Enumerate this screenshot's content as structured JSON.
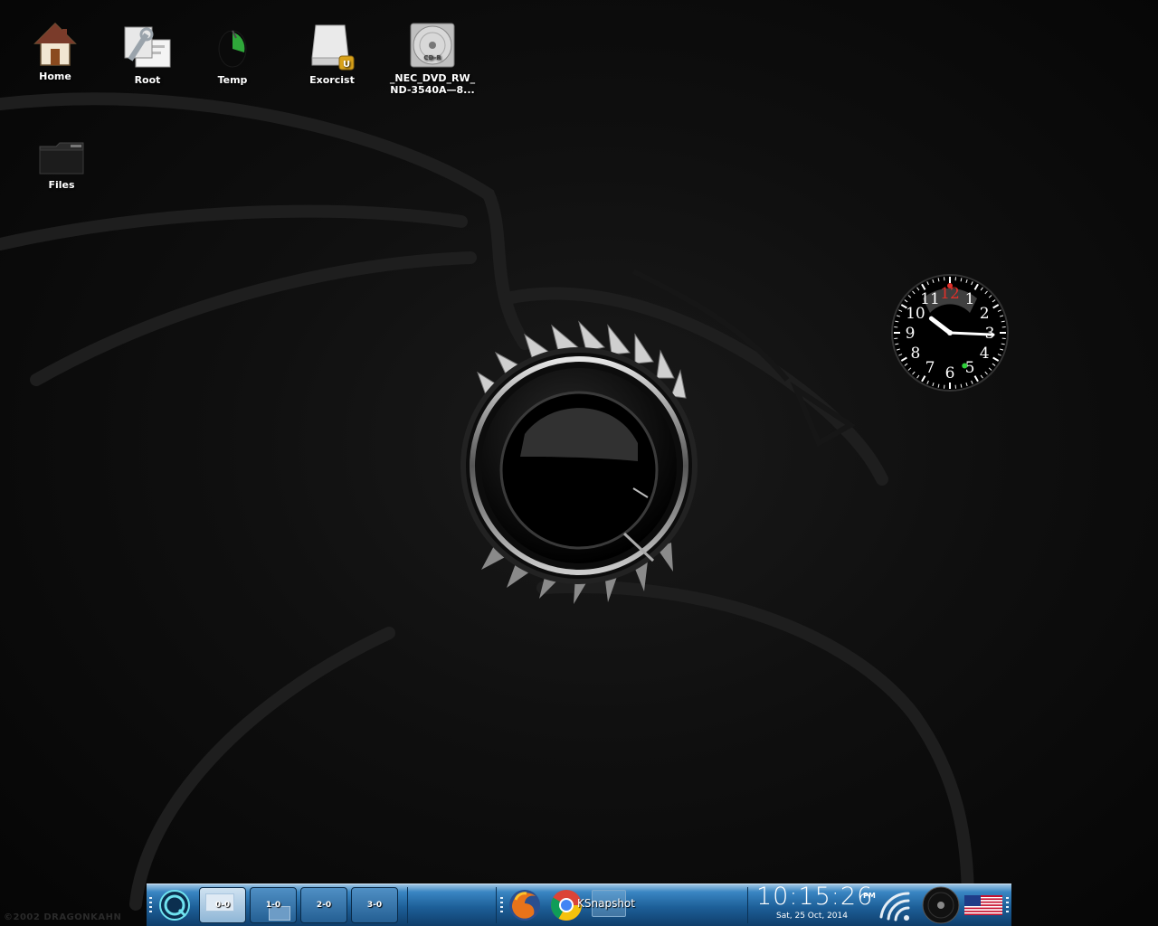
{
  "desktop": {
    "icons": [
      {
        "label": "Home"
      },
      {
        "label": "Root"
      },
      {
        "label": "Temp"
      },
      {
        "label": "Exorcist"
      },
      {
        "label": "_NEC_DVD_RW_\nND-3540A—8..."
      },
      {
        "label": "Files"
      }
    ],
    "cd_badge": "CD-R",
    "drive_badge": "U",
    "watermark": "©2002 DRAGONKAHN"
  },
  "analog_clock": {
    "numerals": [
      "12",
      "1",
      "2",
      "3",
      "4",
      "5",
      "6",
      "7",
      "8",
      "9",
      "10",
      "11"
    ],
    "hour": 10,
    "minute": 15,
    "second": 26
  },
  "taskbar": {
    "pagers": [
      {
        "label": "0-0",
        "active": true
      },
      {
        "label": "1-0",
        "active": false
      },
      {
        "label": "2-0",
        "active": false
      },
      {
        "label": "3-0",
        "active": false
      }
    ],
    "task_label": "KSnapshot",
    "clock_time": "10:15:26",
    "clock_ampm": "PM",
    "clock_date": "Sat, 25 Oct, 2014"
  },
  "colors": {
    "taskbar_top": "#9fc6e4",
    "taskbar_bottom": "#0f3e6b",
    "clock_accent": "#e0302a"
  }
}
